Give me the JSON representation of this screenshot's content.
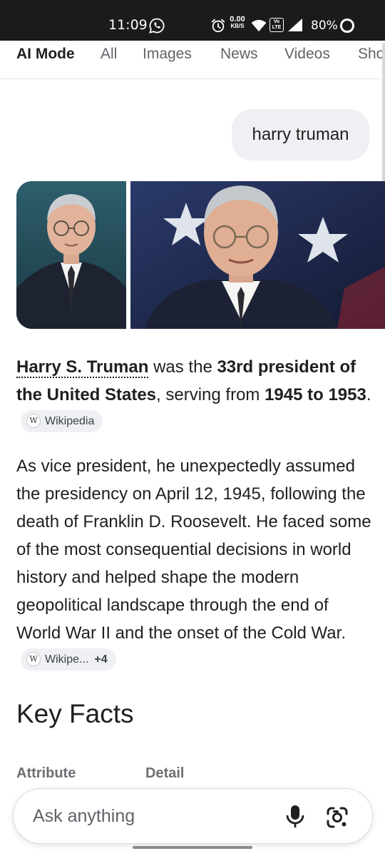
{
  "status_bar": {
    "time": "11:09",
    "net_speed_value": "0.00",
    "net_speed_unit": "KB/S",
    "volte_top": "Vo",
    "volte_bottom": "LTE",
    "battery": "80%"
  },
  "tabs": [
    {
      "label": "AI Mode",
      "active": true
    },
    {
      "label": "All"
    },
    {
      "label": "Images"
    },
    {
      "label": "News"
    },
    {
      "label": "Videos"
    },
    {
      "label": "Sho"
    }
  ],
  "query": "harry truman",
  "answer": {
    "p1": {
      "name": "Harry S. Truman",
      "t1": " was the ",
      "b1": "33rd president of the United States",
      "t2": ", serving from ",
      "b2": "1945 to 1953",
      "t3": ".",
      "source": "Wikipedia"
    },
    "p2": {
      "text": "As vice president, he unexpectedly assumed the presidency on April 12, 1945, following the death of Franklin D. Roosevelt. He faced some of the most consequential decisions in world history and helped shape the modern geopolitical landscape through the end of World War II and the onset of the Cold War.",
      "source": "Wikipe...",
      "more": "+4"
    }
  },
  "key_facts": {
    "heading": "Key Facts",
    "col_attribute": "Attribute",
    "col_detail": "Detail"
  },
  "search_bar": {
    "placeholder": "Ask anything"
  },
  "colors": {
    "status_bar_bg": "#1b1b1e",
    "chip_bg": "#eef0f3",
    "text": "#1f1f1f",
    "muted": "#5f6368"
  }
}
